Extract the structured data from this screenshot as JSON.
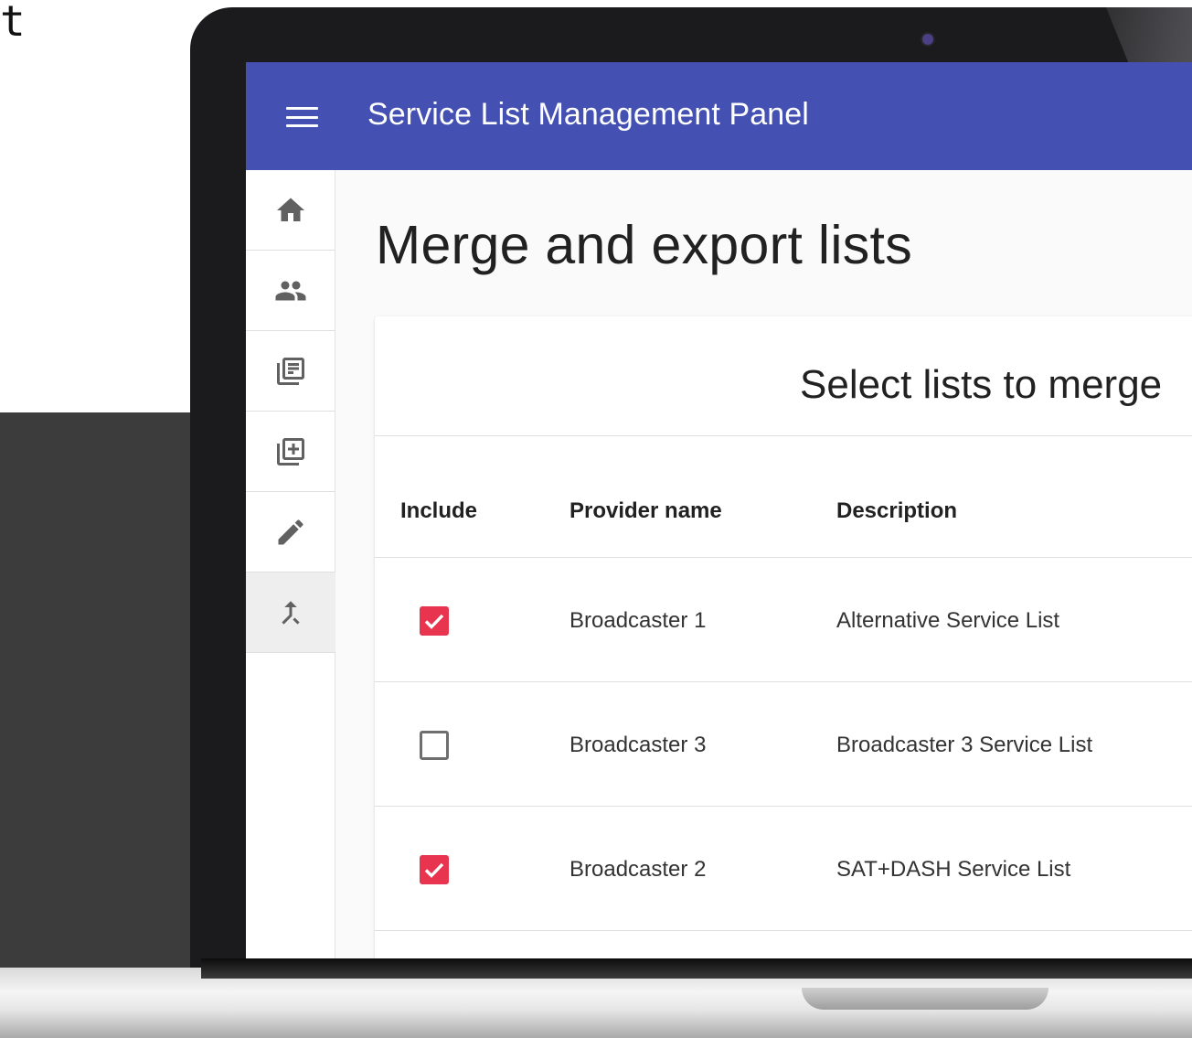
{
  "corner_glyph": "t",
  "app_bar": {
    "title": "Service List Management Panel",
    "background": "#4451b2"
  },
  "side_nav": {
    "items": [
      {
        "icon": "home-icon",
        "selected": false
      },
      {
        "icon": "people-icon",
        "selected": false
      },
      {
        "icon": "list-document-icon",
        "selected": false
      },
      {
        "icon": "add-library-icon",
        "selected": false
      },
      {
        "icon": "edit-pencil-icon",
        "selected": false
      },
      {
        "icon": "merge-icon",
        "selected": true
      }
    ]
  },
  "page": {
    "title": "Merge and export lists"
  },
  "card": {
    "title": "Select lists to merge",
    "columns": {
      "include": "Include",
      "provider": "Provider name",
      "description": "Description"
    },
    "rows": [
      {
        "include": true,
        "provider": "Broadcaster 1",
        "description": "Alternative Service List"
      },
      {
        "include": false,
        "provider": "Broadcaster 3",
        "description": "Broadcaster 3 Service List"
      },
      {
        "include": true,
        "provider": "Broadcaster 2",
        "description": "SAT+DASH Service List"
      }
    ]
  },
  "colors": {
    "accent_checkbox": "#e8344e",
    "text_primary": "#212121"
  }
}
